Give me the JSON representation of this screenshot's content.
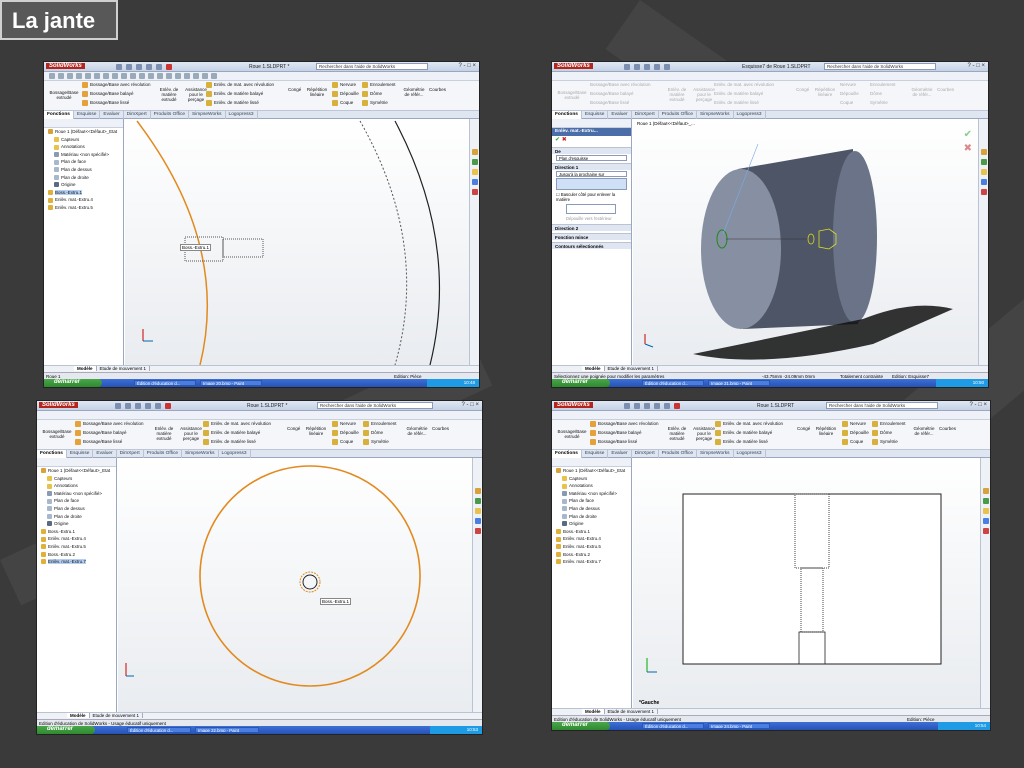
{
  "slide_title": "La jante",
  "common": {
    "app_name": "SolidWorks",
    "search_placeholder": "Rechercher dans l'aide de SolidWorks",
    "window_buttons": "? - □ ×",
    "start_label": "démarrer",
    "task_edition": "Édition d'éducation d...",
    "ribbon": {
      "bossage_extrude": "Bossage/Base extrudé",
      "bossage_revolution": "Bossage/Base avec révolution",
      "bossage_balaye": "Bossage/Base balayé",
      "bossage_lisse": "Bossage/Base lissé",
      "enlev_extrude": "Enlèv. de matière extrudé",
      "assistance_percage": "Assistance pour le perçage",
      "enlev_revolution": "Enlèv. de mat. avec révolution",
      "enlev_balaye": "Enlèv. de matière balayé",
      "enlev_lisse": "Enlèv. de matière lissé",
      "conge": "Congé",
      "repetition": "Répétition linéaire",
      "nervure": "Nervure",
      "depouille": "Dépouille",
      "coque": "Coque",
      "enroulement": "Enroulement",
      "dome": "Dôme",
      "symetrie": "Symétrie",
      "geometrie": "Géométrie de référ...",
      "courbes": "Courbes"
    },
    "tabs": [
      "Fonctions",
      "Esquisse",
      "Evaluer",
      "DimXpert",
      "Produits Office",
      "SimpseWorks",
      "Logopress3"
    ],
    "bottom_tabs": [
      "Modèle",
      "Etude de mouvement 1"
    ]
  },
  "screens": [
    {
      "doc_title": "Roue 1.SLDPRT *",
      "tree_root": "Roue 1 (Défaut<<Défaut>_Etat",
      "tree_items": [
        "Capteurs",
        "Annotations",
        "Matériau <non spécifié>",
        "Plan de face",
        "Plan de dessus",
        "Plan de droite",
        "Origine",
        "Boss.-Extru.1",
        "Enlèv. mat.-Extru.4",
        "Enlèv. mat.-Extru.5"
      ],
      "tooltip": "Boss.-Extru.1",
      "status_left": "Roue 1",
      "status_right": "Edition: Pièce",
      "task2": "Image 20.bmp - Paint",
      "clock": "10:48"
    },
    {
      "doc_title": "Esquisse7 de Roue 1.SLDPRT",
      "tree_root": "Roue 1 (Défaut<<Défaut>_...",
      "pm_title": "Enlèv. mat.-Extru...",
      "pm_de": "De",
      "pm_plan": "Plan d'esquisse",
      "pm_direction1": "Direction 1",
      "pm_condition": "Jusqu'à la prochaine sur",
      "pm_basculer": "Basculer côté pour enlever la matière",
      "pm_depouille": "Dépouille vers l'extérieur",
      "pm_direction2": "Direction 2",
      "pm_fonction_mince": "Fonction mince",
      "pm_contours": "Contours sélectionnés",
      "status_left": "Sélectionnez une poignée pour modifier les paramètres",
      "status_coords": "-43.75mm    -24.09mm    0mm",
      "status_constraint": "Totalement contrainte",
      "status_right": "Edition: Esquisse7",
      "task2": "Image 21.bmp - Paint",
      "clock": "10:50"
    },
    {
      "doc_title": "Roue 1.SLDPRT *",
      "tree_root": "Roue 1 (Défaut<<Défaut>_Etat",
      "tree_items": [
        "Capteurs",
        "Annotations",
        "Matériau <non spécifié>",
        "Plan de face",
        "Plan de dessus",
        "Plan de droite",
        "Origine",
        "Boss.-Extru.1",
        "Enlèv. mat.-Extru.4",
        "Enlèv. mat.-Extru.5",
        "Boss.-Extru.2",
        "Enlèv. mat.-Extru.7"
      ],
      "tooltip": "Boss.-Extru.1",
      "status_left": "Edition d'éducation de SolidWorks - Usage éducatif uniquement",
      "task2": "Image 22.bmp - Paint",
      "clock": "10:53"
    },
    {
      "doc_title": "Roue 1.SLDPRT",
      "tree_root": "Roue 1 (Défaut<<Défaut>_Etat",
      "tree_items": [
        "Capteurs",
        "Annotations",
        "Matériau <non spécifié>",
        "Plan de face",
        "Plan de dessus",
        "Plan de droite",
        "Origine",
        "Boss.-Extru.1",
        "Enlèv. mat.-Extru.4",
        "Enlèv. mat.-Extru.5",
        "Boss.-Extru.2",
        "Enlèv. mat.-Extru.7"
      ],
      "view_label": "*Gauche",
      "status_left": "Edition d'éducation de SolidWorks - Usage éducatif uniquement",
      "status_right": "Edition: Pièce",
      "task2": "Image 24.bmp - Paint",
      "clock": "10:54"
    }
  ]
}
